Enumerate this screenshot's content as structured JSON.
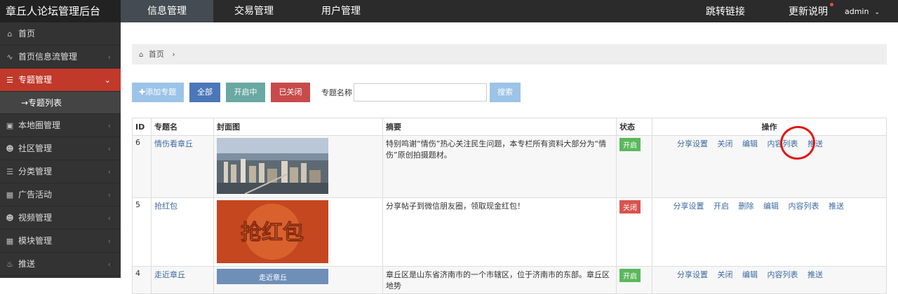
{
  "brand": "章丘人论坛管理后台",
  "topnav": [
    "信息管理",
    "交易管理",
    "用户管理"
  ],
  "top_right": {
    "jump_link": "跳转链接",
    "update_notes": "更新说明",
    "user": "admin"
  },
  "sidebar": {
    "items": [
      {
        "label": "首页",
        "icon": "home-icon"
      },
      {
        "label": "首页信息流管理",
        "icon": "rss-icon"
      },
      {
        "label": "专题管理",
        "icon": "list-icon"
      },
      {
        "label": "→专题列表",
        "icon": ""
      },
      {
        "label": "本地圈管理",
        "icon": "image-icon"
      },
      {
        "label": "社区管理",
        "icon": "users-icon"
      },
      {
        "label": "分类管理",
        "icon": "list-icon"
      },
      {
        "label": "广告活动",
        "icon": "calendar-icon"
      },
      {
        "label": "视频管理",
        "icon": "users-icon"
      },
      {
        "label": "模块管理",
        "icon": "sitemap-icon"
      },
      {
        "label": "推送",
        "icon": "bell-icon"
      }
    ]
  },
  "breadcrumb": {
    "home": "首页"
  },
  "toolbar": {
    "add": "✚添加专题",
    "all": "全部",
    "open": "开启中",
    "closed": "已关闭",
    "name_label": "专题名称",
    "search": "搜索"
  },
  "table": {
    "headers": [
      "ID",
      "专题名",
      "封面图",
      "摘要",
      "状态",
      "操作"
    ],
    "rows": [
      {
        "id": "6",
        "name": "情伤看章丘",
        "summary": "特别鸣谢“情伤”热心关注民生问题，本专栏所有资料大部分为“情伤”原创拍摄题材。",
        "status": "开启",
        "ops": [
          "分享设置",
          "关闭",
          "编辑",
          "内容列表",
          "推送"
        ]
      },
      {
        "id": "5",
        "name": "抢红包",
        "summary": "分享帖子到微信朋友圈，领取现金红包！",
        "status": "关闭",
        "ops": [
          "分享设置",
          "开启",
          "删除",
          "编辑",
          "内容列表",
          "推送"
        ]
      },
      {
        "id": "4",
        "name": "走近章丘",
        "summary": "章丘区是山东省济南市的一个市辖区，位于济南市的东部。章丘区地势",
        "status": "开启",
        "ops": [
          "分享设置",
          "关闭",
          "编辑",
          "内容列表",
          "推送"
        ]
      }
    ]
  },
  "cover_banner_text": "抢红包",
  "cover_text_3": "走近章丘",
  "colors": {
    "accent_red": "#c0392b",
    "sidebar": "#333333",
    "topbar": "#2b2b2b"
  }
}
